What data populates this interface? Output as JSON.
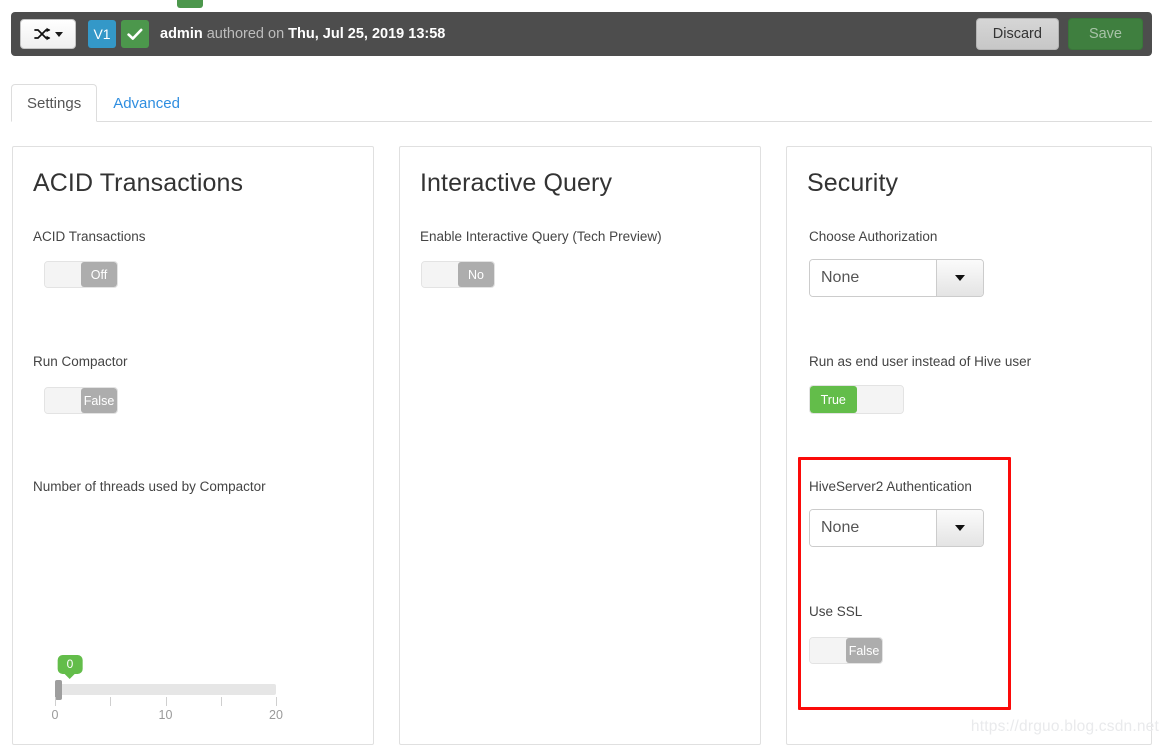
{
  "header": {
    "compare_icon": "shuffle-icon",
    "compare_caret": "caret-down-icon",
    "version_badge": "V1",
    "status_icon": "check-icon",
    "authored_prefix": "admin",
    "authored_mid": " authored on ",
    "authored_date": "Thu, Jul 25, 2019 13:58",
    "discard_label": "Discard",
    "save_label": "Save",
    "bar_color": "#4d4d4d",
    "version_badge_color": "#3498c8",
    "status_badge_color": "#4c974c",
    "save_color": "#3f7f3f"
  },
  "top_chip": {
    "label": "",
    "color": "#4c974c"
  },
  "tabs": [
    {
      "label": "Settings",
      "active": true
    },
    {
      "label": "Advanced",
      "active": false
    }
  ],
  "panels": {
    "acid": {
      "title": "ACID Transactions",
      "toggle_label": "ACID Transactions",
      "toggle_value": "Off",
      "compactor_label": "Run Compactor",
      "compactor_value": "False",
      "slider_label": "Number of threads used by Compactor",
      "slider_value": "0"
    },
    "interactive_query": {
      "title": "Interactive Query",
      "toggle_label": "Enable Interactive Query (Tech Preview)",
      "toggle_value": "No"
    },
    "security": {
      "title": "Security",
      "authorization_label": "Choose Authorization",
      "authorization_value": "None",
      "runas_label": "Run as end user instead of Hive user",
      "runas_value": "True",
      "hs2auth_label": "HiveServer2 Authentication",
      "hs2auth_value": "None",
      "ssl_label": "Use SSL",
      "ssl_value": "False",
      "highlight_color": "#fb0a09"
    }
  },
  "slider_scale": {
    "ticks": [
      0,
      5,
      10,
      15,
      20
    ],
    "labels": [
      {
        "text": "0",
        "pos": 0
      },
      {
        "text": "10",
        "pos": 50
      },
      {
        "text": "20",
        "pos": 100
      }
    ],
    "min": 0,
    "max": 20
  },
  "watermark": "https://drguo.blog.csdn.net",
  "colors": {
    "toggle_off": "#adadad",
    "toggle_on": "#63bd4a",
    "tab_link": "#2f8ee0"
  }
}
